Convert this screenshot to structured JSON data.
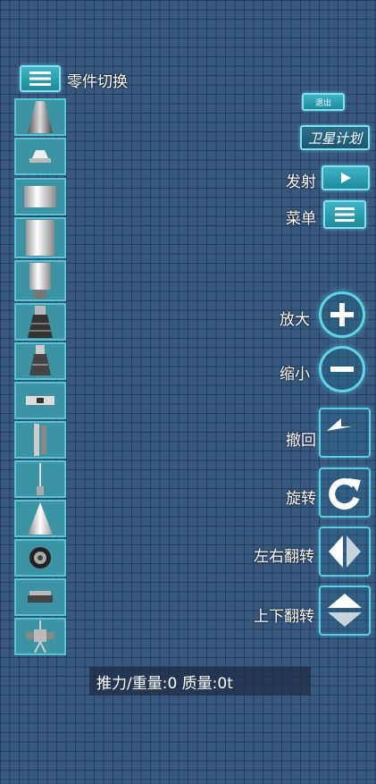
{
  "header": {
    "parts_toggle_label": "零件切换"
  },
  "top_right": {
    "exit_label": "退出",
    "satellite_plan_label": "卫星计划",
    "launch_label": "发射",
    "menu_label": "菜单"
  },
  "tools": {
    "zoom_in_label": "放大",
    "zoom_out_label": "缩小",
    "undo_label": "撤回",
    "rotate_label": "旋转",
    "flip_horizontal_label": "左右翻转",
    "flip_vertical_label": "上下翻转"
  },
  "status": {
    "text": "推力/重量:0 质量:0t"
  },
  "parts": [
    "nose-cone-part-icon",
    "small-cap-part-icon",
    "short-tank-part-icon",
    "tall-tank-part-icon",
    "tank-with-nozzle-part-icon",
    "engine-part-icon",
    "small-engine-part-icon",
    "separator-part-icon",
    "side-rail-part-icon",
    "antenna-part-icon",
    "cone-part-icon",
    "wheel-part-icon",
    "dock-part-icon",
    "probe-part-icon"
  ],
  "colors": {
    "accent": "#3fb4c4",
    "background": "#38587e"
  }
}
